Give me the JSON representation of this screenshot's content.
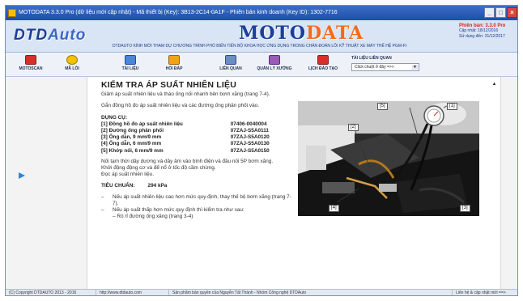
{
  "window": {
    "title": "MOTODATA 3.3.0 Pro (dữ liệu mới cập nhật) - Mã thiết bị (Key): 3B13-2C14-0A1F - Phiên bản kinh doanh (Key ID): 1302-7716"
  },
  "header": {
    "logo_main": "DTD",
    "logo_accent": "Auto",
    "brand_main": "MOTO",
    "brand_accent": "DATA",
    "tagline": "DTDAUTO KÍNH MỜI THAM DỰ CHƯƠNG TRÌNH PHỔ BIẾN TIẾN BỘ KHOA HỌC ỨNG DỤNG TRONG CHẨN ĐOÁN LỖI KỸ THUẬT XE MÁY THẾ HỆ PGM-FI",
    "version_label": "Phiên bản: 3.3.0 Pro",
    "update_date": "Cập nhật: 18/12/2016",
    "expiry": "Sử dụng đến: 31/12/2017"
  },
  "toolbar": {
    "items": [
      {
        "label": "MOTOSCAN",
        "icon": "scanner-icon",
        "color": "#d92f2a"
      },
      {
        "label": "MÃ LỖI",
        "icon": "warning-light-icon",
        "color": "#f2c200"
      },
      {
        "label": "TÀI LIỆU",
        "icon": "document-icon",
        "color": "#4a86d8"
      },
      {
        "label": "HỎI ĐÁP",
        "icon": "question-icon",
        "color": "#f2a21a"
      },
      {
        "label": "LIÊN QUAN",
        "icon": "link-icon",
        "color": "#6a8ec4"
      },
      {
        "label": "QUẢN LÝ XƯỞNG",
        "icon": "workshop-icon",
        "color": "#9a5ab8"
      },
      {
        "label": "LỊCH ĐÀO TẠO",
        "icon": "calendar-icon",
        "color": "#d92f2a"
      }
    ],
    "related_label": "TÀI LIỆU LIÊN QUAN",
    "related_select_value": "Click chuột ở đây =>>"
  },
  "document": {
    "title": "KIỂM TRA ÁP SUẤT NHIÊN LIỆU",
    "para1": "Giảm áp suất nhiên liệu và tháo ống nối nhanh bên bơm xăng (trang 7-4).",
    "para2": "Gắn đồng hồ đo áp suất nhiên liệu và các đường ống phân phối vào.",
    "tools_heading": "DỤNG CỤ:",
    "tools": [
      {
        "name": "[1] Đồng hồ đo áp suất nhiên liệu",
        "part": "07406-0040004"
      },
      {
        "name": "[2] Đường ống phân phối",
        "part": "07ZAJ-S5A0111"
      },
      {
        "name": "[3] Ống dẫn, 9 mm/9 mm",
        "part": "07ZAJ-S5A0120"
      },
      {
        "name": "[4] Ống dẫn, 6 mm/9 mm",
        "part": "07ZAJ-S5A0130"
      },
      {
        "name": "[5] Khớp nối, 6 mm/9 mm",
        "part": "07ZAJ-S5A0150"
      }
    ],
    "para3": "Nối tạm thời dây dương và dây âm vào bình điện và đầu nối 5P bơm xăng.",
    "para4": "Khởi động động cơ và để nổ ở tốc độ cầm chừng.",
    "para5": "Đọc áp suất nhiên liệu.",
    "spec_label": "TIÊU CHUẨN:",
    "spec_value": "294 kPa",
    "bullet1": "Nếu áp suất nhiên liệu cao hơn mức quy định, thay thế bộ bơm xăng (trang 7-7).",
    "bullet2": "Nếu áp suất thấp hơn mức quy định thì kiểm tra như sau:",
    "sub1": "– Rò rỉ đường ống xăng (trang 3-4)",
    "dash": "–",
    "callouts": [
      "[1]",
      "[2]",
      "[3]",
      "[4]",
      "[5]"
    ]
  },
  "statusbar": {
    "copyright": "(C) Copyright DTDAUTO 2013 - 2016",
    "website": "http://www.dtdauto.com",
    "credit": "Sản phẩm bản quyền của Nguyễn Tất Thành - Nhóm Công nghệ DTDAuto",
    "contact": "Liên hệ & cập nhật mới ==>"
  }
}
